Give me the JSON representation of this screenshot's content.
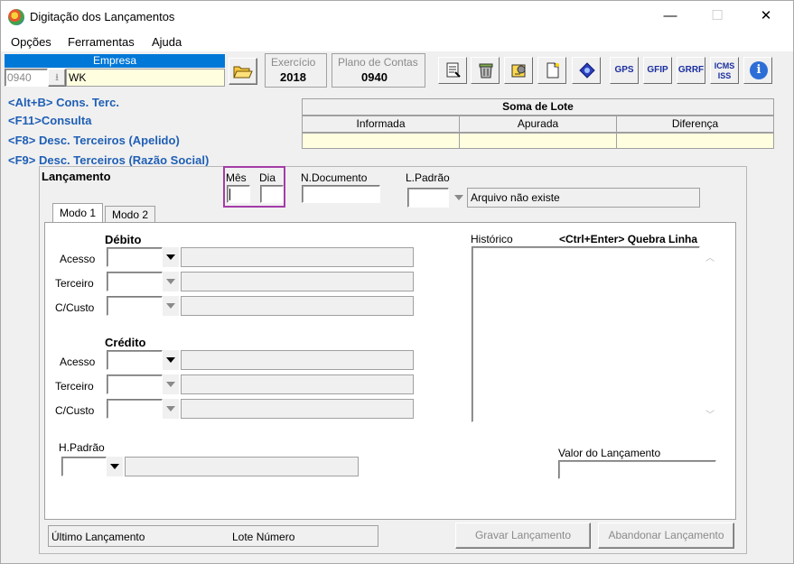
{
  "window": {
    "title": "Digitação dos Lançamentos",
    "minimize": "—",
    "maximize": "☐",
    "close": "✕"
  },
  "menu": {
    "items": [
      "Opções",
      "Ferramentas",
      "Ajuda"
    ]
  },
  "empresa": {
    "label": "Empresa",
    "code": "0940",
    "name": "WK"
  },
  "exercicio": {
    "label": "Exercício",
    "value": "2018"
  },
  "plano": {
    "label": "Plano de Contas",
    "value": "0940"
  },
  "toolbar": {
    "gps": "GPS",
    "gfip": "GFIP",
    "grrf": "GRRF",
    "icms": "ICMS ISS",
    "info": "i"
  },
  "hints": [
    "<Alt+B> Cons. Terc.",
    "<F11>Consulta",
    "<F8> Desc. Terceiros (Apelido)",
    "<F9> Desc. Terceiros (Razão Social)"
  ],
  "soma": {
    "title": "Soma de Lote",
    "informada": "Informada",
    "apurada": "Apurada",
    "diferenca": "Diferença"
  },
  "lancamento": {
    "title": "Lançamento",
    "mes": "Mês",
    "dia": "Dia",
    "ndoc": "N.Documento",
    "lpadrao": "L.Padrão",
    "lpadrao_desc": "Arquivo não existe"
  },
  "tabs": [
    "Modo 1",
    "Modo 2"
  ],
  "debito": {
    "title": "Débito",
    "acesso": "Acesso",
    "terceiro": "Terceiro",
    "ccusto": "C/Custo"
  },
  "credito": {
    "title": "Crédito",
    "acesso": "Acesso",
    "terceiro": "Terceiro",
    "ccusto": "C/Custo"
  },
  "historico": {
    "label": "Histórico",
    "hint": "<Ctrl+Enter> Quebra Linha"
  },
  "hpadrao": {
    "label": "H.Padrão"
  },
  "valor": {
    "label": "Valor do Lançamento"
  },
  "status": {
    "ultimo": "Último Lançamento",
    "lote": "Lote Número"
  },
  "buttons": {
    "gravar": "Gravar Lançamento",
    "abandonar": "Abandonar Lançamento"
  },
  "colors": {
    "accent": "#0078d7",
    "hint": "#1f5fb5",
    "highlight": "#a43ca8",
    "yellow": "#ffffe0"
  }
}
